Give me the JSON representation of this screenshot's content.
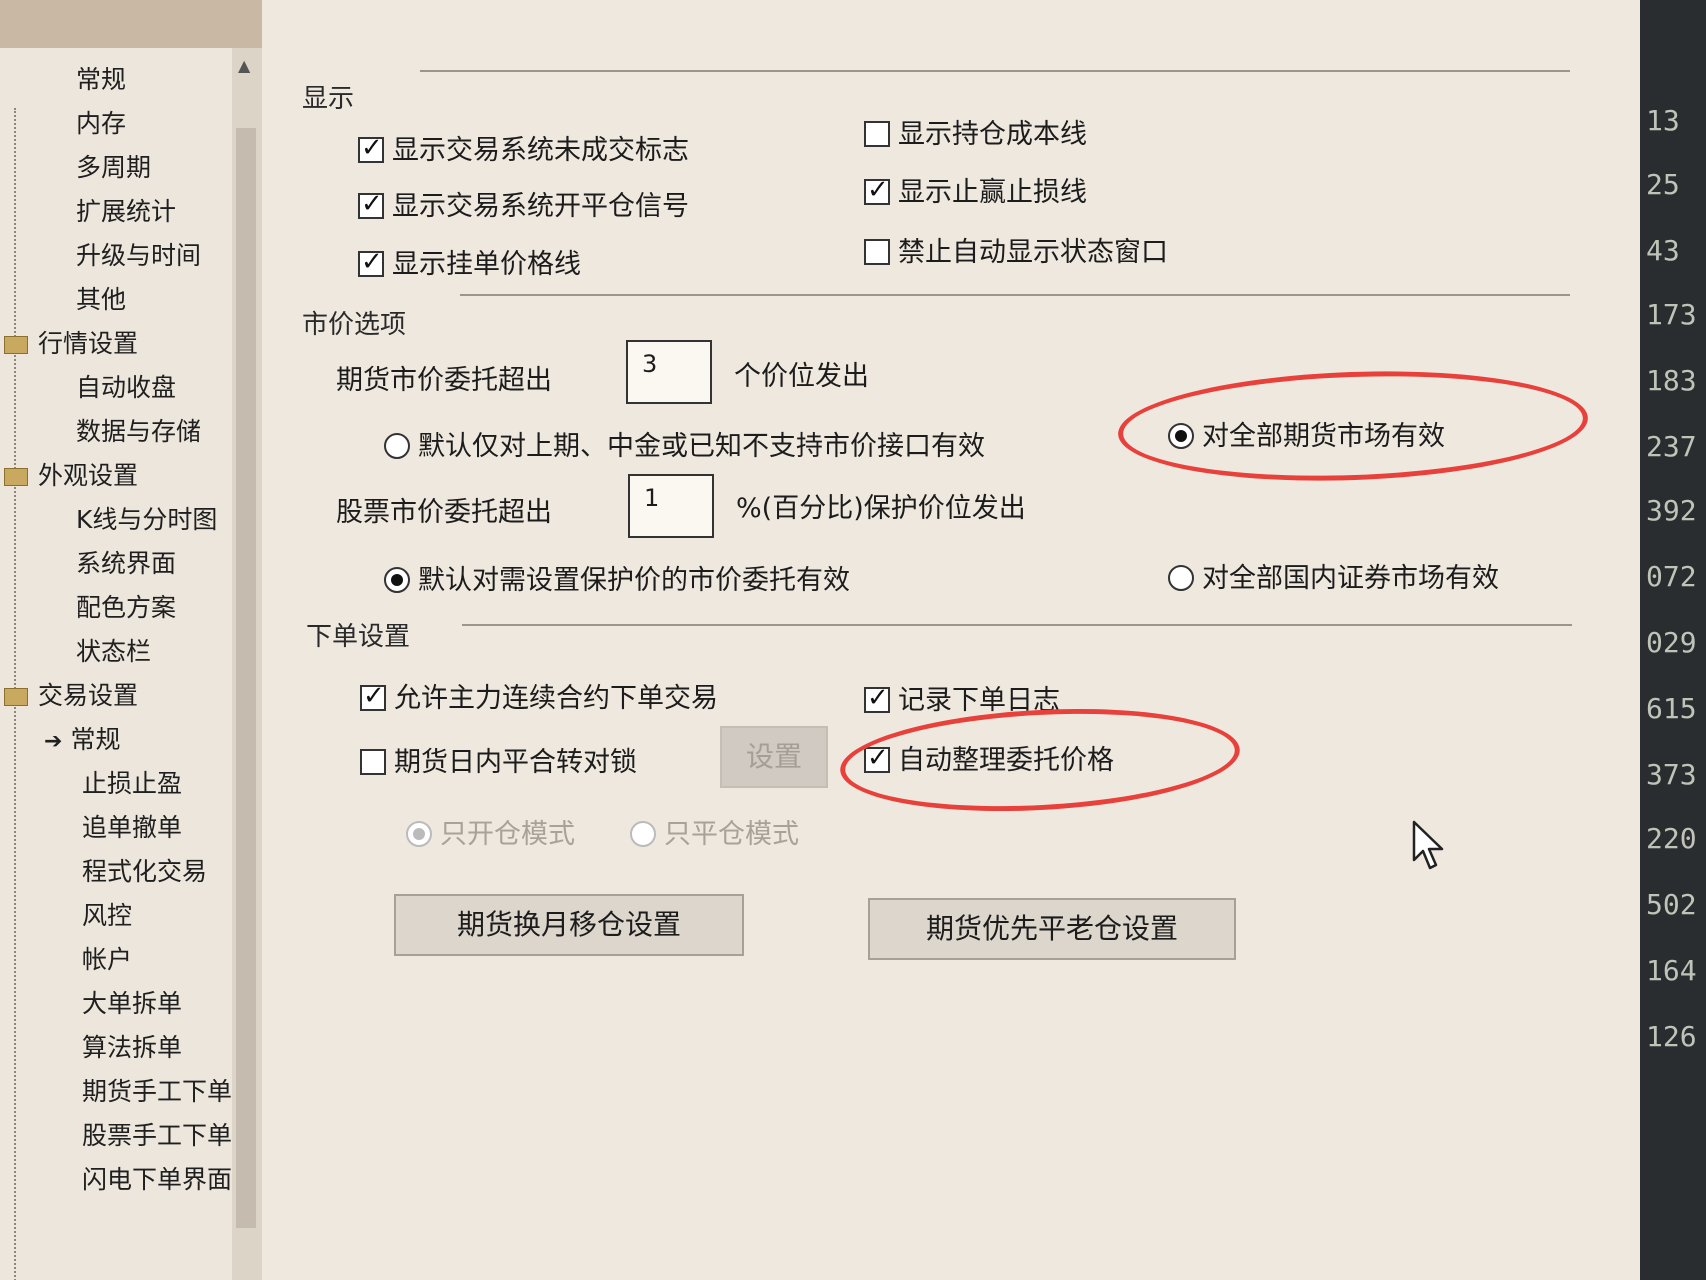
{
  "tree": {
    "items": [
      {
        "label": "常规"
      },
      {
        "label": "内存"
      },
      {
        "label": "多周期"
      },
      {
        "label": "扩展统计"
      },
      {
        "label": "升级与时间"
      },
      {
        "label": "其他"
      },
      {
        "label": "行情设置"
      },
      {
        "label": "自动收盘"
      },
      {
        "label": "数据与存储"
      },
      {
        "label": "外观设置"
      },
      {
        "label": "K线与分时图"
      },
      {
        "label": "系统界面"
      },
      {
        "label": "配色方案"
      },
      {
        "label": "状态栏"
      },
      {
        "label": "交易设置"
      },
      {
        "label": "常规"
      },
      {
        "label": "止损止盈"
      },
      {
        "label": "追单撤单"
      },
      {
        "label": "程式化交易"
      },
      {
        "label": "风控"
      },
      {
        "label": "帐户"
      },
      {
        "label": "大单拆单"
      },
      {
        "label": "算法拆单"
      },
      {
        "label": "期货手工下单"
      },
      {
        "label": "股票手工下单"
      },
      {
        "label": "闪电下单界面"
      }
    ]
  },
  "display": {
    "title": "显示",
    "show_unfilled_flag": "显示交易系统未成交标志",
    "show_open_close_signal": "显示交易系统开平仓信号",
    "show_order_price_line": "显示挂单价格线",
    "show_position_cost_line": "显示持仓成本线",
    "show_tp_sl_line": "显示止赢止损线",
    "disable_auto_status_window": "禁止自动显示状态窗口"
  },
  "market": {
    "title": "市价选项",
    "futures_label": "期货市价委托超出",
    "futures_value": "3",
    "futures_suffix": "个价位发出",
    "futures_opt_default": "默认仅对上期、中金或已知不支持市价接口有效",
    "futures_opt_all": "对全部期货市场有效",
    "stock_label": "股票市价委托超出",
    "stock_value": "1",
    "stock_suffix": "%(百分比)保护价位发出",
    "stock_opt_default": "默认对需设置保护价的市价委托有效",
    "stock_opt_all": "对全部国内证券市场有效"
  },
  "order": {
    "title": "下单设置",
    "allow_main_contract": "允许主力连续合约下单交易",
    "record_order_log": "记录下单日志",
    "intraday_close_to_lock": "期货日内平合转对锁",
    "set_button": "设置",
    "auto_arrange_price": "自动整理委托价格",
    "open_only_mode": "只开仓模式",
    "close_only_mode": "只平仓模式",
    "rollover_button": "期货换月移仓设置",
    "priority_close_button": "期货优先平老仓设置"
  },
  "right_numbers": [
    "13",
    "25",
    "43",
    "173",
    "183",
    "237",
    "392",
    "072",
    "029",
    "615",
    "373",
    "220",
    "502",
    "164",
    "126"
  ],
  "colors": {
    "annotation": "#e8403a"
  }
}
